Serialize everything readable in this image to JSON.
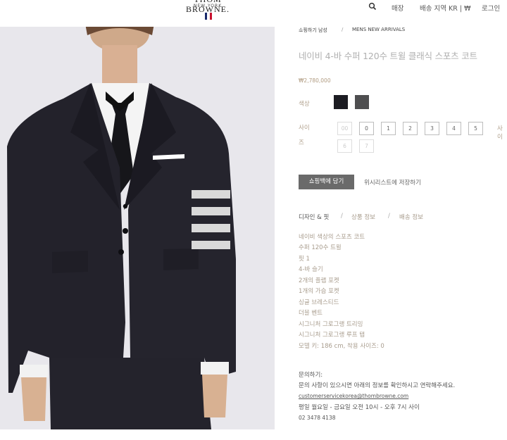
{
  "header": {
    "brand": "THOM BROWNE.",
    "brand_sub": "NEW YORK",
    "flag_colors": [
      "#1a2a6c",
      "#ffffff",
      "#c8102e"
    ],
    "nav": {
      "search_icon": "search-icon",
      "stores": "매장",
      "shipping_region": "배송 지역 KR | ₩",
      "login": "로그인"
    }
  },
  "breadcrumb": {
    "items": [
      "쇼핑하기 남성",
      "MENS NEW ARRIVALS"
    ],
    "separator": "/"
  },
  "product": {
    "title": "네이비 4-바 수퍼 120수 트윌 클래식 스포츠 코트",
    "price": "₩2,780,000",
    "color_label": "색상",
    "colors": [
      {
        "name": "navy",
        "hex": "#1c1c22"
      },
      {
        "name": "grey",
        "hex": "#4e4e50"
      }
    ],
    "size_label_1": "사이",
    "size_label_2": "즈",
    "sizes_row1": [
      "00",
      "0",
      "1",
      "2",
      "3",
      "4",
      "5"
    ],
    "sizes_row2": [
      "6",
      "7"
    ],
    "size_guide": "사이",
    "add_to_bag": "쇼핑백에 담기",
    "wishlist": "위시리스트에 저장하기"
  },
  "tabs": {
    "items": [
      "디자인 & 핏",
      "상품 정보",
      "배송 정보"
    ],
    "separator": "/"
  },
  "details": [
    "네이비 색상의 스포츠 코트",
    "수퍼 120수 트윌",
    "핏 1",
    "4-바 슬기",
    "2개의 플랩 포켓",
    "1개의 가슴 포켓",
    "싱글 브레스티드",
    "더블 벤트",
    "시그니처 그로그랭 트리밍",
    "시그니처 그로그랭 루프 탭",
    "모델 키: 186 cm, 착용 사이즈: 0"
  ],
  "contact": {
    "heading": "문의하기:",
    "message": "문의 사항이 있으시면 아래의 정보를 확인하시고 연락해주세요.",
    "email": "customerservicekorea@thombrowne.com",
    "hours": "평일 월요일 - 금요일 오전 10시 - 오후 7시 사이",
    "phone": "02 3478 4138"
  }
}
